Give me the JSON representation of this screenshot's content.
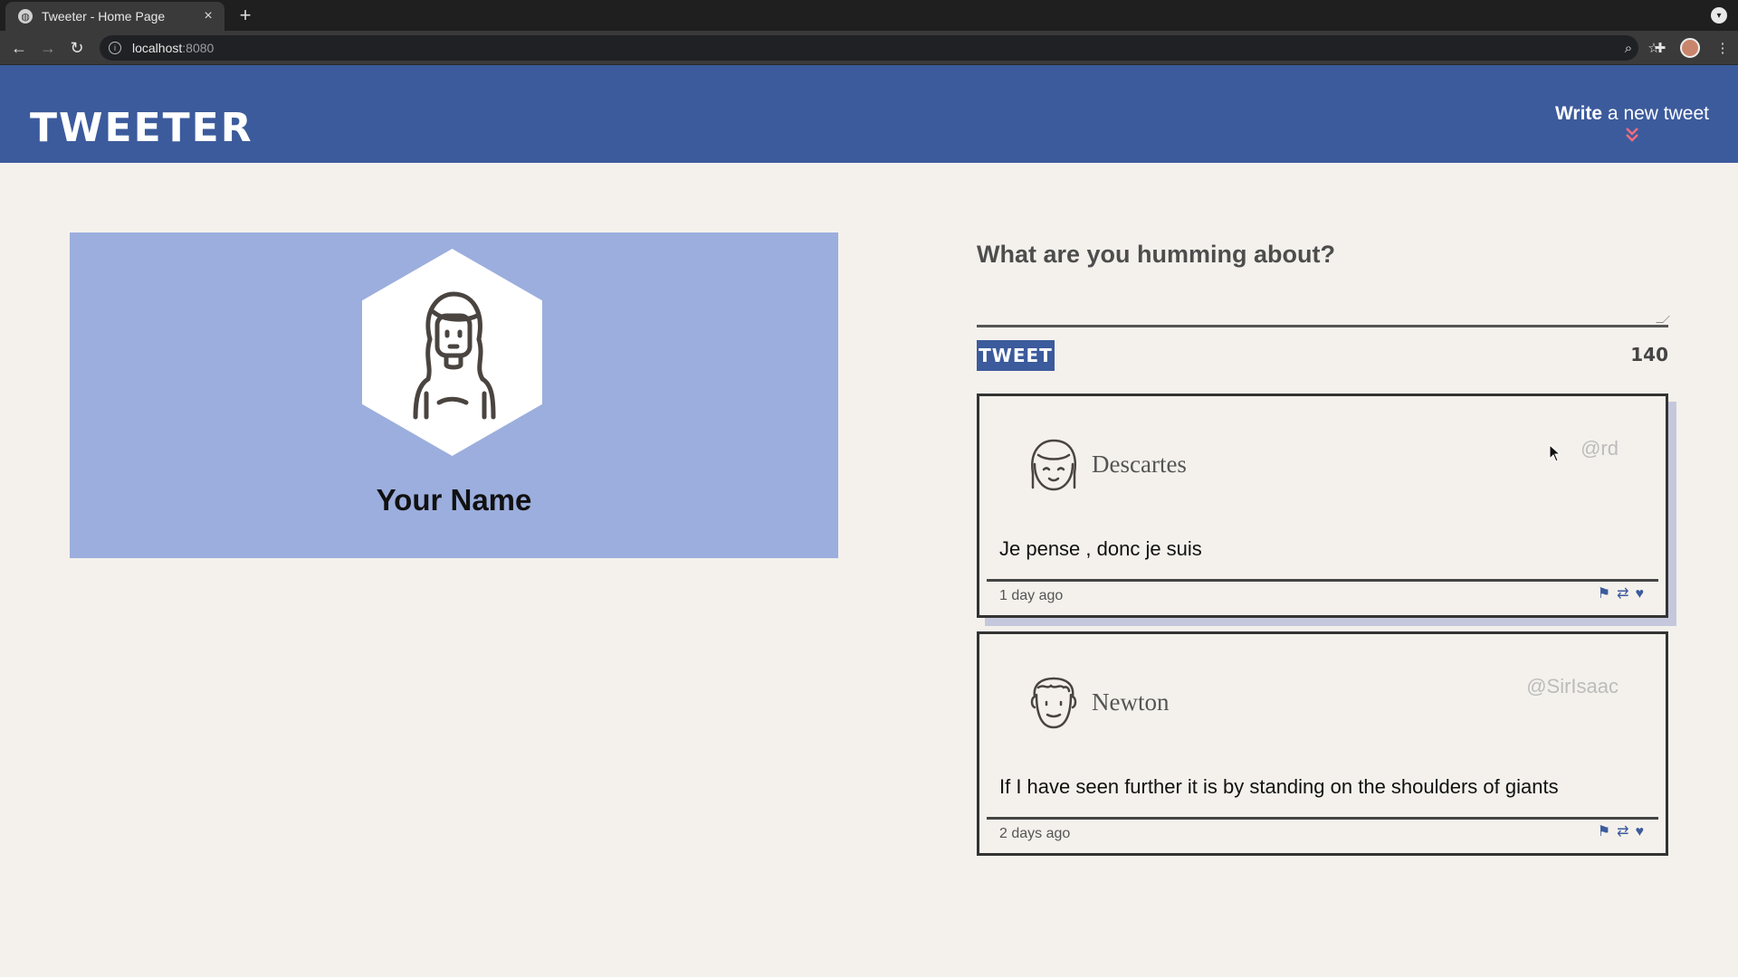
{
  "browser": {
    "tab_title": "Tweeter - Home Page",
    "tab_close": "×",
    "new_tab": "+",
    "url_host": "localhost",
    "url_port": ":8080"
  },
  "header": {
    "brand": "TWEETER",
    "compose_bold": "Write",
    "compose_rest": " a new tweet",
    "compose_chevron": "⌄"
  },
  "profile": {
    "name": "Your Name"
  },
  "composer": {
    "prompt": "What are you humming about?",
    "submit_label": "TWEET",
    "counter": "140"
  },
  "tweets": [
    {
      "author": "Descartes",
      "handle": "@rd",
      "text": "Je pense , donc je suis",
      "time": "1 day ago"
    },
    {
      "author": "Newton",
      "handle": "@SirIsaac",
      "text": "If I have seen further it is by standing on the shoulders of giants",
      "time": "2 days ago"
    }
  ],
  "icons": {
    "flag": "flag-icon",
    "retweet": "retweet-icon",
    "like": "heart-icon"
  },
  "colors": {
    "header_bg": "#3c5b9c",
    "profile_bg": "#9caedd",
    "page_bg": "#f4f1ec",
    "accent_chevron": "#f26d7d"
  }
}
